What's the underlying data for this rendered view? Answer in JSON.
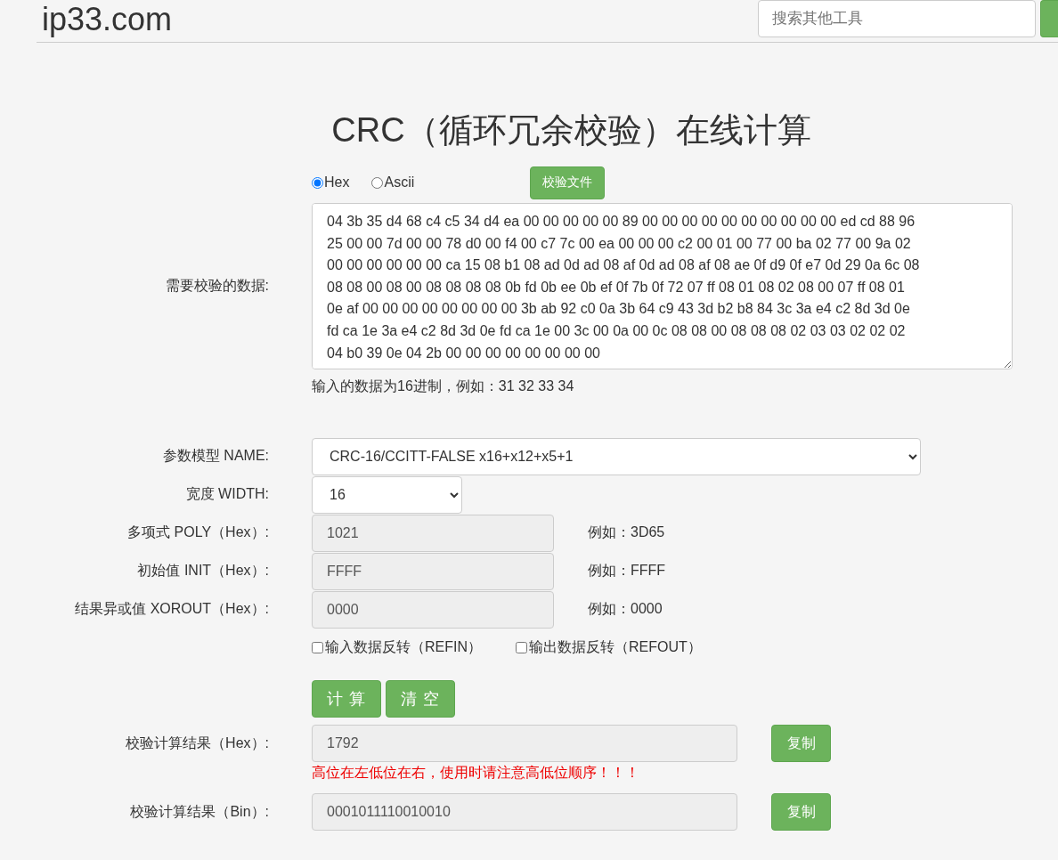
{
  "header": {
    "logo": "ip33.com",
    "search": {
      "placeholder": "搜索其他工具"
    }
  },
  "title": "CRC（循环冗余校验）在线计算",
  "input_mode": [
    {
      "label": "Hex",
      "selected": true
    },
    {
      "label": "Ascii",
      "selected": false
    }
  ],
  "file_button": "校验文件",
  "data_label": "需要校验的数据:",
  "data_lines": [
    "04 3b 35 d4 68 c4 c5 34 d4 ea 00 00 00 00 00 89 00 00 00 00 00 00 00 00 00 00 ed cd 88 96",
    "25 00 00 7d 00 00 78 d0 00 f4 00 c7 7c 00 ea 00 00 00 c2 00 01 00 77 00 ba 02 77 00 9a 02",
    "00 00 00 00 00 00 ca 15 08 b1 08 ad 0d ad 08 af 0d ad 08 af 08 ae 0f d9 0f e7 0d 29 0a 6c 08",
    "08 08 00 08 00 08 08 08 08 0b fd 0b ee 0b ef 0f 7b 0f 72 07 ff 08 01 08 02 08 00 07 ff 08 01",
    "0e af 00 00 00 00 00 00 00 00 3b ab 92 c0 0a 3b 64 c9 43 3d b2 b8 84 3c 3a e4 c2 8d 3d 0e",
    "fd ca 1e 3a e4 c2 8d 3d 0e fd ca 1e 00 3c 00 0a 00 0c 08 08 00 08 08 08 02 03 03 02 02 02",
    "04 b0 39 0e 04 2b 00 00 00 00 00 00 00 00"
  ],
  "data_hint": "输入的数据为16进制，例如：31 32 33 34",
  "model": {
    "label": "参数模型 NAME:",
    "value": "CRC-16/CCITT-FALSE       x16+x12+x5+1"
  },
  "width": {
    "label": "宽度 WIDTH:",
    "value": "16"
  },
  "params": [
    {
      "label": "多项式 POLY（Hex）:",
      "value": "1021",
      "example": "例如：3D65"
    },
    {
      "label": "初始值 INIT（Hex）:",
      "value": "FFFF",
      "example": "例如：FFFF"
    },
    {
      "label": "结果异或值 XOROUT（Hex）:",
      "value": "0000",
      "example": "例如：0000"
    }
  ],
  "reflect": [
    {
      "label": "输入数据反转（REFIN）",
      "checked": false
    },
    {
      "label": "输出数据反转（REFOUT）",
      "checked": false
    }
  ],
  "actions": [
    "计 算",
    "清 空"
  ],
  "results": [
    {
      "label": "校验计算结果（Hex）:",
      "value": "1792",
      "copy": "复制",
      "warning": "高位在左低位在右，使用时请注意高低位顺序！！！"
    },
    {
      "label": "校验计算结果（Bin）:",
      "value": "0001011110010010",
      "copy": "复制"
    }
  ]
}
